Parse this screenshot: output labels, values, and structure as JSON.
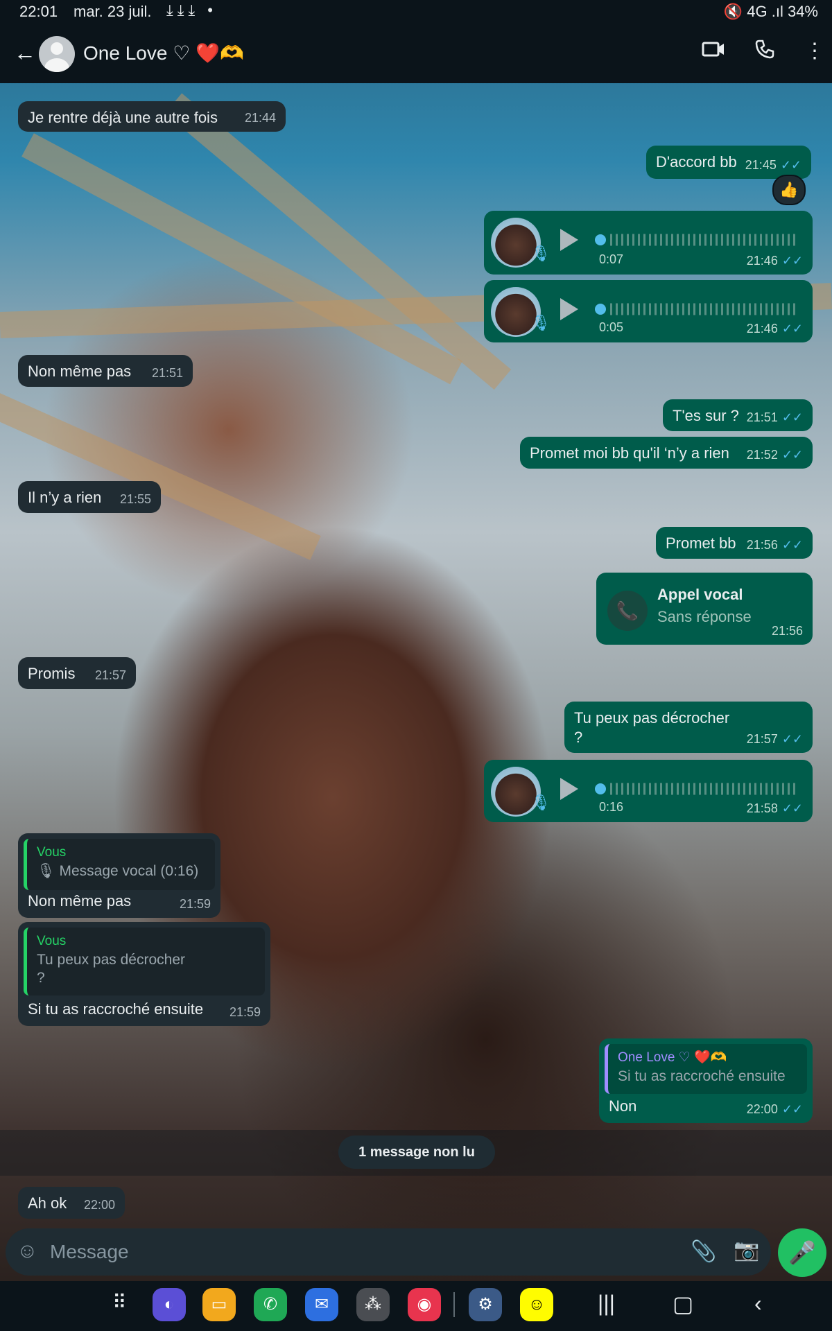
{
  "status": {
    "time": "22:01",
    "date": "mar. 23 juil.",
    "downloads": "⤓⤓⤓ •",
    "right": "🔇 4G .ıl 34%"
  },
  "header": {
    "contact_name": "One Love ♡ ❤️🫶"
  },
  "messages": {
    "m1": {
      "text": "Je rentre déjà une autre fois",
      "time": "21:44"
    },
    "m2": {
      "text": "D'accord bb",
      "time": "21:45",
      "reaction": "👍"
    },
    "m3": {
      "duration": "0:07",
      "time": "21:46"
    },
    "m4": {
      "duration": "0:05",
      "time": "21:46"
    },
    "m5": {
      "text": "Non même pas",
      "time": "21:51"
    },
    "m6": {
      "text": "T'es sur ?",
      "time": "21:51"
    },
    "m7": {
      "text": "Promet moi bb qu'il ‘n’y a rien",
      "time": "21:52"
    },
    "m8": {
      "text": "Il n’y a rien",
      "time": "21:55"
    },
    "m9": {
      "text": "Promet bb",
      "time": "21:56"
    },
    "m10": {
      "title": "Appel vocal",
      "subtitle": "Sans réponse",
      "time": "21:56"
    },
    "m11": {
      "text": "Promis",
      "time": "21:57"
    },
    "m12": {
      "line1": "Tu peux pas décrocher",
      "line2": "?",
      "time": "21:57"
    },
    "m13": {
      "duration": "0:16",
      "time": "21:58"
    },
    "m14": {
      "quote_name": "Vous",
      "quote_text": "🎙 Message vocal (0:16)",
      "text": "Non même pas",
      "time": "21:59"
    },
    "m15": {
      "quote_name": "Vous",
      "quote_line1": "Tu peux pas décrocher",
      "quote_line2": "?",
      "text": "Si tu as raccroché ensuite",
      "time": "21:59"
    },
    "m16": {
      "quote_name": "One Love ♡ ❤️🫶",
      "quote_text": "Si tu as raccroché ensuite",
      "text": "Non",
      "time": "22:00"
    },
    "m17": {
      "text": "Ah ok",
      "time": "22:00"
    }
  },
  "unread": "1 message non lu",
  "input": {
    "placeholder": "Message"
  },
  "colors": {
    "incoming": "#202c33",
    "outgoing": "#005c4b",
    "accent": "#21c063",
    "tick": "#53bdeb"
  }
}
